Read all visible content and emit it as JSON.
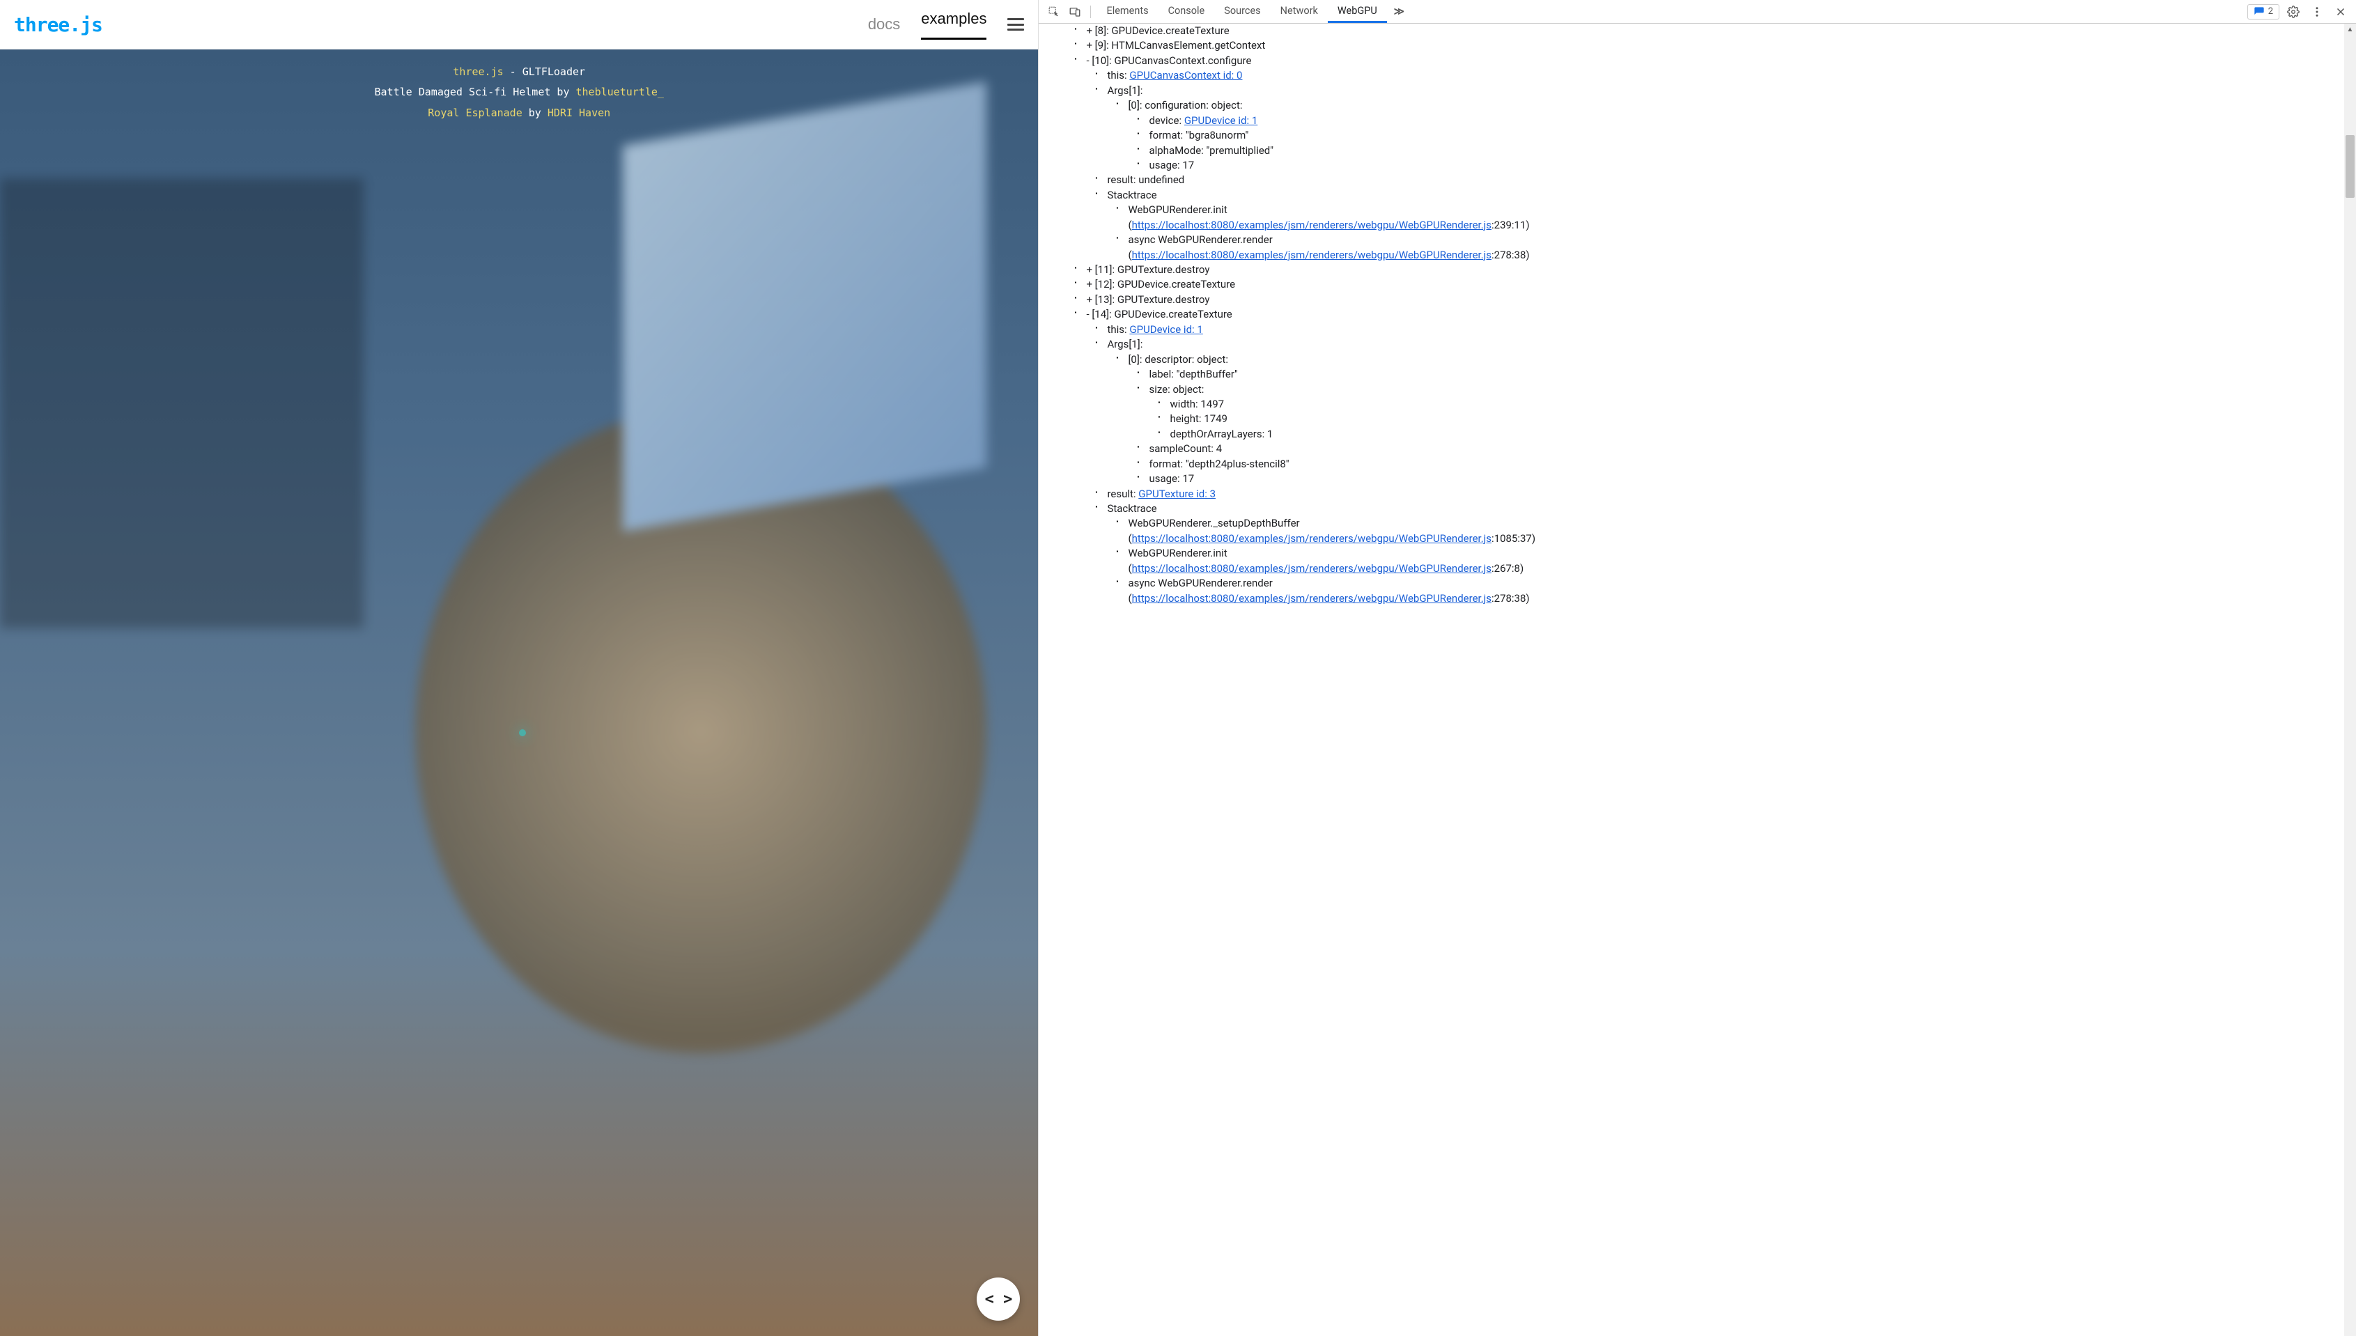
{
  "page": {
    "logo": "three.js",
    "nav": {
      "docs": "docs",
      "examples": "examples"
    },
    "info": {
      "l1_link": "three.js",
      "l1_rest": " - GLTFLoader",
      "l2_pre": "Battle Damaged Sci-fi Helmet by ",
      "l2_link": "theblueturtle_",
      "l3_link1": "Royal Esplanade",
      "l3_mid": " by ",
      "l3_link2": "HDRI Haven"
    },
    "code_btn": "< >"
  },
  "devtools": {
    "tabs": [
      "Elements",
      "Console",
      "Sources",
      "Network",
      "WebGPU"
    ],
    "active_tab": "WebGPU",
    "more": "≫",
    "issues_count": "2",
    "tree": {
      "n8": {
        "label": "+ [8]: GPUDevice.createTexture"
      },
      "n9": {
        "label": "+ [9]: HTMLCanvasElement.getContext"
      },
      "n10": {
        "label": "- [10]: GPUCanvasContext.configure",
        "this_pre": "this: ",
        "this_link": "GPUCanvasContext id: 0",
        "args": "Args[1]:",
        "a0": "[0]: configuration: object:",
        "device_pre": "device: ",
        "device_link": "GPUDevice id: 1",
        "format": "format: \"bgra8unorm\"",
        "alpha": "alphaMode: \"premultiplied\"",
        "usage": "usage: 17",
        "result": "result: undefined",
        "stack": "Stacktrace",
        "st1a": "WebGPURenderer.init",
        "st1b_open": "(",
        "st1b_link": "https://localhost:8080/examples/jsm/renderers/webgpu/WebGPURenderer.js",
        "st1b_close": ":239:11)",
        "st2a": "async WebGPURenderer.render",
        "st2b_open": "(",
        "st2b_link": "https://localhost:8080/examples/jsm/renderers/webgpu/WebGPURenderer.js",
        "st2b_close": ":278:38)"
      },
      "n11": {
        "label": "+ [11]: GPUTexture.destroy"
      },
      "n12": {
        "label": "+ [12]: GPUDevice.createTexture"
      },
      "n13": {
        "label": "+ [13]: GPUTexture.destroy"
      },
      "n14": {
        "label": "- [14]: GPUDevice.createTexture",
        "this_pre": "this: ",
        "this_link": "GPUDevice id: 1",
        "args": "Args[1]:",
        "a0": "[0]: descriptor: object:",
        "labelv": "label: \"depthBuffer\"",
        "size": "size: object:",
        "w": "width: 1497",
        "h": "height: 1749",
        "d": "depthOrArrayLayers: 1",
        "samp": "sampleCount: 4",
        "format": "format: \"depth24plus-stencil8\"",
        "usage": "usage: 17",
        "result_pre": "result: ",
        "result_link": "GPUTexture id: 3",
        "stack": "Stacktrace",
        "st1a": "WebGPURenderer._setupDepthBuffer",
        "st1b_open": "(",
        "st1b_link": "https://localhost:8080/examples/jsm/renderers/webgpu/WebGPURenderer.js",
        "st1b_close": ":1085:37)",
        "st2a": "WebGPURenderer.init",
        "st2b_open": "(",
        "st2b_link": "https://localhost:8080/examples/jsm/renderers/webgpu/WebGPURenderer.js",
        "st2b_close": ":267:8)",
        "st3a": "async WebGPURenderer.render",
        "st3b_open": "(",
        "st3b_link": "https://localhost:8080/examples/jsm/renderers/webgpu/WebGPURenderer.js",
        "st3b_close": ":278:38)"
      }
    }
  }
}
